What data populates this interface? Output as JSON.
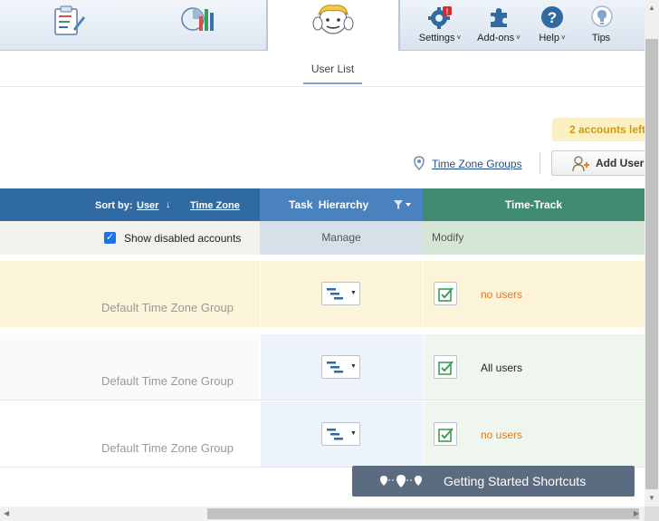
{
  "nav": {
    "settings_label": "Settings",
    "addons_label": "Add-ons",
    "help_label": "Help",
    "tips_label": "Tips",
    "settings_badge": "!"
  },
  "subtab": {
    "label": "User List"
  },
  "toolbar": {
    "accounts_left": "2 accounts left",
    "timezone_groups_link": "Time Zone Groups",
    "add_user_label": "Add User"
  },
  "table": {
    "sort_by_label": "Sort by:",
    "sort_user": "User",
    "sort_arrow": "↓",
    "sort_timezone": "Time Zone",
    "task_hierarchy_header": "Task  Hierarchy",
    "time_track_header": "Time-Track",
    "show_disabled_label": "Show disabled accounts",
    "show_disabled_checked": true,
    "manage_label": "Manage",
    "modify_label": "Modify",
    "rows": [
      {
        "group": "Default Time Zone Group",
        "users": "no users",
        "highlight": "#fcf4d9"
      },
      {
        "group": "Default Time Zone Group",
        "users": "All users",
        "highlight": "#fafaf8"
      },
      {
        "group": "Default Time Zone Group",
        "users": "no users",
        "highlight": "#ffffff"
      }
    ]
  },
  "floating": {
    "getting_started_label": "Getting Started Shortcuts"
  },
  "colors": {
    "sort_header": "#2f6aa1",
    "task_header": "#4a82be",
    "time_header": "#418a73",
    "warn_text": "#e07a1e",
    "floating_button": "#5b6b80"
  }
}
